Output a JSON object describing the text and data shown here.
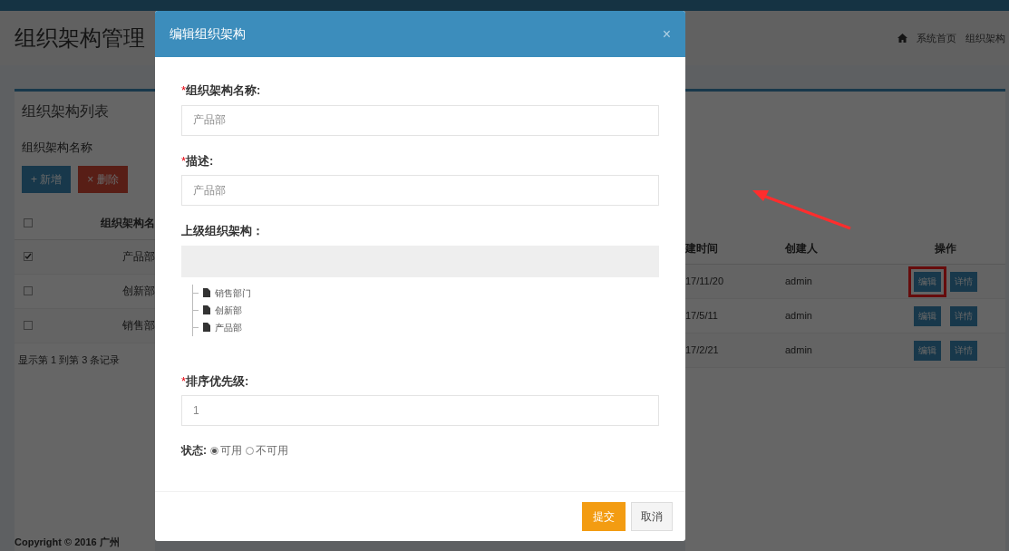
{
  "page": {
    "title": "组织架构管理",
    "breadcrumb": [
      "系统首页",
      "组织架构"
    ],
    "panel_title": "组织架构列表",
    "filter_label": "组织架构名称",
    "buttons": [
      {
        "icon": "+",
        "label": "新增",
        "kind": "primary"
      },
      {
        "icon": "×",
        "label": "删除",
        "kind": "danger"
      }
    ],
    "table": {
      "all_checked": false,
      "columns_left": [
        "组织架构名"
      ],
      "columns_right": [
        "建时间",
        "创建人",
        "操作"
      ],
      "rows": [
        {
          "checked": true,
          "name": "产品部",
          "time": "17/11/20",
          "creator": "admin",
          "actions": [
            "编辑",
            "详情"
          ],
          "highlighted": true
        },
        {
          "checked": false,
          "name": "创新部",
          "time": "17/5/11",
          "creator": "admin",
          "actions": [
            "编辑",
            "详情"
          ],
          "highlighted": false
        },
        {
          "checked": false,
          "name": "销售部",
          "time": "17/2/21",
          "creator": "admin",
          "actions": [
            "编辑",
            "详情"
          ],
          "highlighted": false
        }
      ]
    },
    "summary": "显示第 1 到第 3 条记录",
    "footer": "Copyright © 2016 广州"
  },
  "dialog": {
    "title": "编辑组织架构",
    "close": "×",
    "fields": [
      {
        "kind": "input",
        "required_mark": "*",
        "label": "组织架构名称:",
        "value": "产品部"
      },
      {
        "kind": "input",
        "required_mark": "*",
        "label": "描述:",
        "value": "产品部"
      },
      {
        "kind": "tree",
        "label": "上级组织架构：",
        "children": [
          {
            "label": "销售部门"
          },
          {
            "label": "创新部"
          },
          {
            "label": "产品部"
          }
        ]
      },
      {
        "kind": "input",
        "required_mark": "*",
        "label": "排序优先级:",
        "value": "1"
      },
      {
        "kind": "radio",
        "label": "状态:",
        "options": [
          {
            "label": "可用",
            "selected": true
          },
          {
            "label": "不可用",
            "selected": false
          }
        ]
      }
    ],
    "buttons": [
      {
        "label": "提交",
        "kind": "primary"
      },
      {
        "label": "取消",
        "kind": "default"
      }
    ]
  }
}
